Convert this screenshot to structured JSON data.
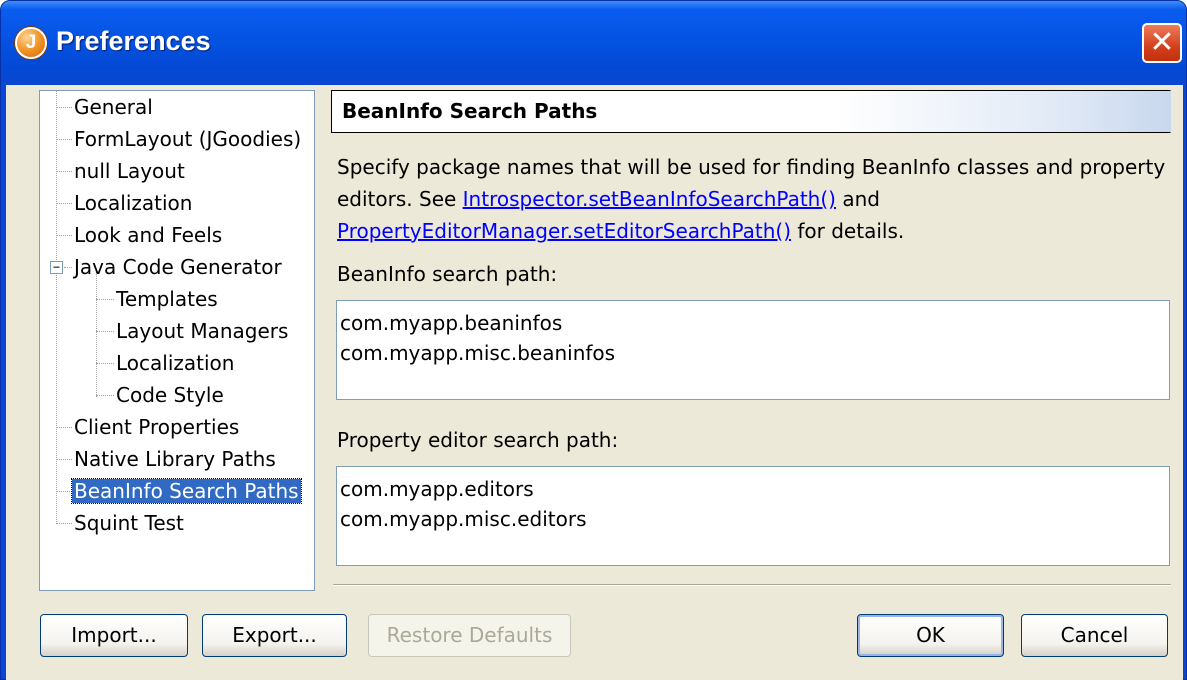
{
  "window": {
    "title": "Preferences",
    "app_icon_letter": "J",
    "close_glyph": "✕"
  },
  "tree": {
    "items": [
      {
        "label": "General"
      },
      {
        "label": "FormLayout (JGoodies)"
      },
      {
        "label": "null Layout"
      },
      {
        "label": "Localization"
      },
      {
        "label": "Look and Feels"
      },
      {
        "label": "Java Code Generator",
        "expanded": true
      },
      {
        "label": "Templates"
      },
      {
        "label": "Layout Managers"
      },
      {
        "label": "Localization"
      },
      {
        "label": "Code Style"
      },
      {
        "label": "Client Properties"
      },
      {
        "label": "Native Library Paths"
      },
      {
        "label": "BeanInfo Search Paths",
        "selected": true
      },
      {
        "label": "Squint Test"
      }
    ],
    "expander_glyph": "−"
  },
  "section": {
    "title": "BeanInfo Search Paths",
    "desc_1": "Specify package names that will be used for finding BeanInfo classes and property editors. See ",
    "link_1": "Introspector.setBeanInfoSearchPath()",
    "desc_2": " and ",
    "link_2": "PropertyEditorManager.setEditorSearchPath()",
    "desc_3": " for details."
  },
  "beaninfo": {
    "label": "BeanInfo search path:",
    "value": "com.myapp.beaninfos\ncom.myapp.misc.beaninfos"
  },
  "editor": {
    "label": "Property editor search path:",
    "value": "com.myapp.editors\ncom.myapp.misc.editors"
  },
  "buttons": {
    "import": "Import...",
    "export": "Export...",
    "restore": "Restore Defaults",
    "ok": "OK",
    "cancel": "Cancel"
  },
  "colors": {
    "title_bar": "#0553e3",
    "dialog_bg": "#ece9d8",
    "selection": "#316ac5",
    "link": "#0000ff"
  }
}
